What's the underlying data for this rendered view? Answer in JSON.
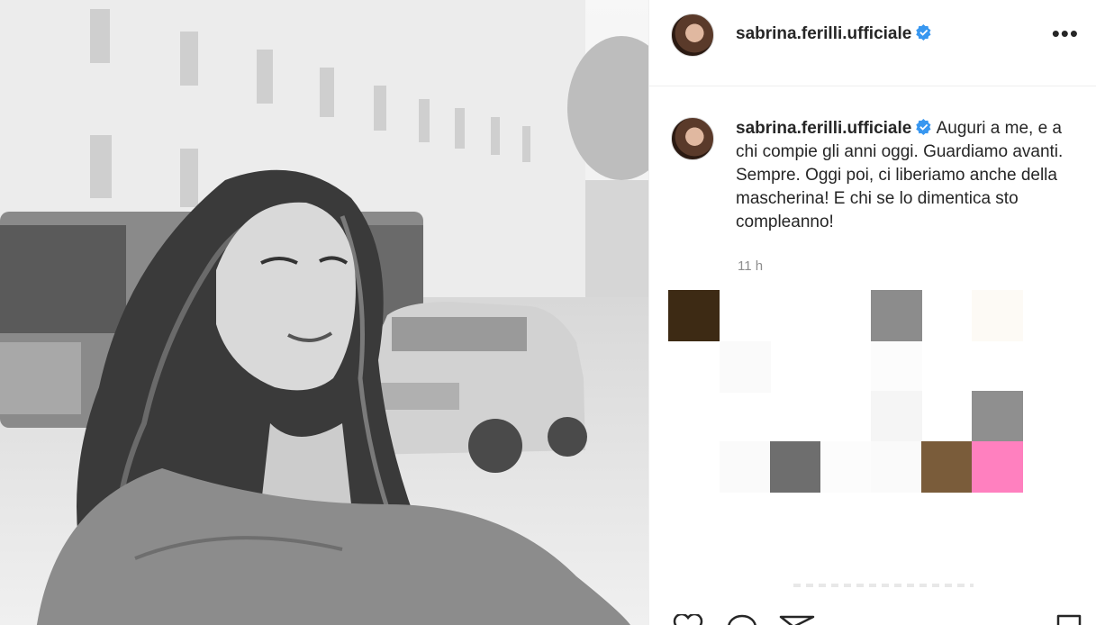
{
  "post": {
    "username": "sabrina.ferilli.ufficiale",
    "verified": true,
    "more_icon": "more-horizontal-icon",
    "caption": "Auguri a me, e a chi compie gli anni oggi. Guardiamo avanti. Sempre. Oggi poi, ci liberiamo anche della mascherina! E chi se lo dimentica sto compleanno!",
    "timestamp": "11 h"
  },
  "actions": {
    "icons": [
      "heart-icon",
      "comment-icon",
      "share-icon",
      "save-icon"
    ]
  },
  "colors": {
    "verified_badge": "#3897f0",
    "text": "#262626",
    "muted": "#8e8e8e",
    "border": "#efefef"
  },
  "mosaic_colors": [
    "#3d2a14",
    "#8c8c8c",
    "#fdfaf5",
    "#fafafa",
    "#f5f5f5",
    "#8f8f8f",
    "#6e6e6e",
    "#fcfcfc",
    "#7a5c3a",
    "#ff80bf"
  ]
}
